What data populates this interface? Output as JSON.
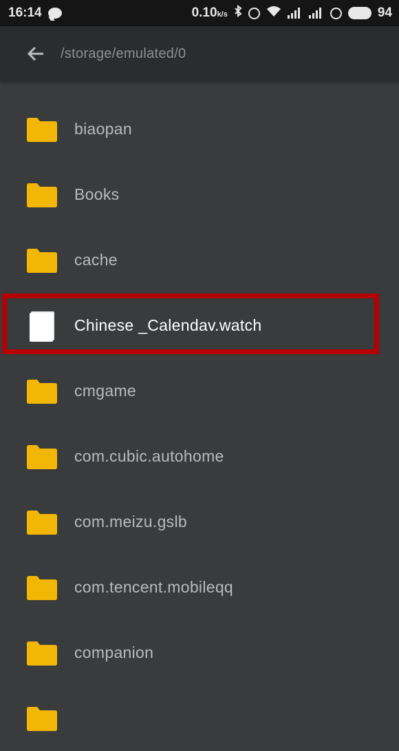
{
  "status_bar": {
    "time": "16:14",
    "network_speed": "0.10",
    "network_unit": "k/s",
    "battery": "94"
  },
  "toolbar": {
    "path": "/storage/emulated/0"
  },
  "files": [
    {
      "name": "biaopan",
      "type": "folder"
    },
    {
      "name": "Books",
      "type": "folder"
    },
    {
      "name": "cache",
      "type": "folder"
    },
    {
      "name": "Chinese _Calendav.watch",
      "type": "file"
    },
    {
      "name": "cmgame",
      "type": "folder"
    },
    {
      "name": "com.cubic.autohome",
      "type": "folder"
    },
    {
      "name": "com.meizu.gslb",
      "type": "folder"
    },
    {
      "name": "com.tencent.mobileqq",
      "type": "folder"
    },
    {
      "name": "companion",
      "type": "folder"
    }
  ],
  "colors": {
    "folder": "#f2b705",
    "highlight": "#b40000",
    "background": "#3a3b3d"
  }
}
